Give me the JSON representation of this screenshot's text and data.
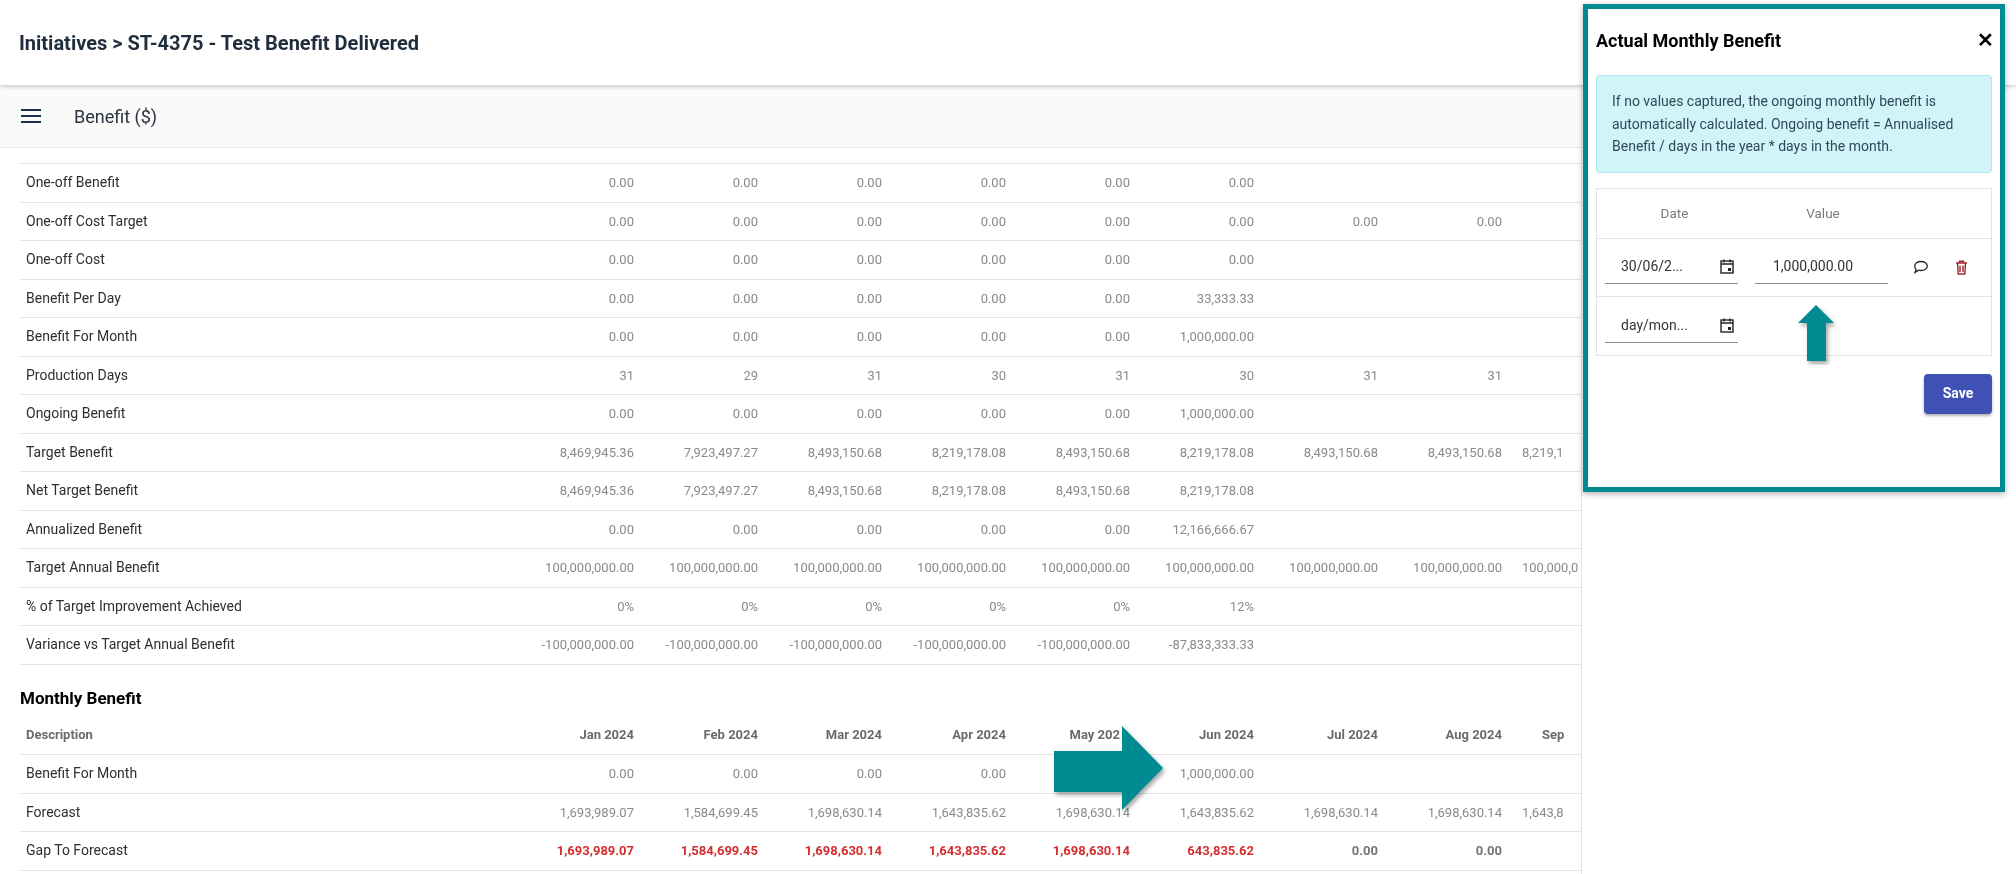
{
  "page_title": "Initiatives > ST-4375 - Test Benefit Delivered",
  "section_tab": "Benefit ($)",
  "summary_table": {
    "rows": [
      {
        "label": "One-off Benefit",
        "cells": [
          "0.00",
          "0.00",
          "0.00",
          "0.00",
          "0.00",
          "0.00"
        ]
      },
      {
        "label": "One-off Cost Target",
        "cells": [
          "0.00",
          "0.00",
          "0.00",
          "0.00",
          "0.00",
          "0.00",
          "0.00",
          "0.00"
        ]
      },
      {
        "label": "One-off Cost",
        "cells": [
          "0.00",
          "0.00",
          "0.00",
          "0.00",
          "0.00",
          "0.00"
        ]
      },
      {
        "label": "Benefit Per Day",
        "cells": [
          "0.00",
          "0.00",
          "0.00",
          "0.00",
          "0.00",
          "33,333.33"
        ]
      },
      {
        "label": "Benefit For Month",
        "cells": [
          "0.00",
          "0.00",
          "0.00",
          "0.00",
          "0.00",
          "1,000,000.00"
        ]
      },
      {
        "label": "Production Days",
        "cells": [
          "31",
          "29",
          "31",
          "30",
          "31",
          "30",
          "31",
          "31"
        ]
      },
      {
        "label": "Ongoing Benefit",
        "cells": [
          "0.00",
          "0.00",
          "0.00",
          "0.00",
          "0.00",
          "1,000,000.00"
        ]
      },
      {
        "label": "Target Benefit",
        "cells": [
          "8,469,945.36",
          "7,923,497.27",
          "8,493,150.68",
          "8,219,178.08",
          "8,493,150.68",
          "8,219,178.08",
          "8,493,150.68",
          "8,493,150.68",
          "8,219,1"
        ]
      },
      {
        "label": "Net Target Benefit",
        "cells": [
          "8,469,945.36",
          "7,923,497.27",
          "8,493,150.68",
          "8,219,178.08",
          "8,493,150.68",
          "8,219,178.08"
        ]
      },
      {
        "label": "Annualized Benefit",
        "cells": [
          "0.00",
          "0.00",
          "0.00",
          "0.00",
          "0.00",
          "12,166,666.67"
        ]
      },
      {
        "label": "Target Annual Benefit",
        "cells": [
          "100,000,000.00",
          "100,000,000.00",
          "100,000,000.00",
          "100,000,000.00",
          "100,000,000.00",
          "100,000,000.00",
          "100,000,000.00",
          "100,000,000.00",
          "100,000,0"
        ]
      },
      {
        "label": "% of Target Improvement Achieved",
        "cells": [
          "0%",
          "0%",
          "0%",
          "0%",
          "0%",
          "12%"
        ]
      },
      {
        "label": "Variance vs Target Annual Benefit",
        "cells": [
          "-100,000,000.00",
          "-100,000,000.00",
          "-100,000,000.00",
          "-100,000,000.00",
          "-100,000,000.00",
          "-87,833,333.33"
        ]
      }
    ]
  },
  "monthly_benefit": {
    "title": "Monthly Benefit",
    "columns": [
      "Description",
      "Jan 2024",
      "Feb 2024",
      "Mar 2024",
      "Apr 2024",
      "May 202",
      "Jun 2024",
      "Jul 2024",
      "Aug 2024",
      "Sep"
    ],
    "rows": [
      {
        "cells": [
          "Benefit For Month",
          "0.00",
          "0.00",
          "0.00",
          "0.00",
          null,
          "1,000,000.00"
        ]
      },
      {
        "cells": [
          "Forecast",
          "1,693,989.07",
          "1,584,699.45",
          "1,698,630.14",
          "1,643,835.62",
          "1,698,630.14",
          "1,643,835.62",
          "1,698,630.14",
          "1,698,630.14",
          "1,643,8"
        ]
      },
      {
        "bold": true,
        "cells": [
          "Gap To Forecast",
          {
            "text": "1,693,989.07",
            "alert": true
          },
          {
            "text": "1,584,699.45",
            "alert": true
          },
          {
            "text": "1,698,630.14",
            "alert": true
          },
          {
            "text": "1,643,835.62",
            "alert": true
          },
          {
            "text": "1,698,630.14",
            "alert": true
          },
          {
            "text": "643,835.62",
            "alert": true
          },
          {
            "text": "0.00",
            "alert": false
          },
          {
            "text": "0.00",
            "alert": false
          }
        ]
      }
    ]
  },
  "dialog": {
    "title": "Actual Monthly Benefit",
    "close": "✕",
    "info": "If no values captured, the ongoing monthly benefit is automatically calculated. Ongoing benefit = Annualised Benefit / days in the year * days in the month.",
    "columns": [
      "Date",
      "Value"
    ],
    "entries": [
      {
        "date": "30/06/2...",
        "value": "1,000,000.00"
      },
      {
        "date": "day/mon..."
      }
    ],
    "save": "Save"
  }
}
